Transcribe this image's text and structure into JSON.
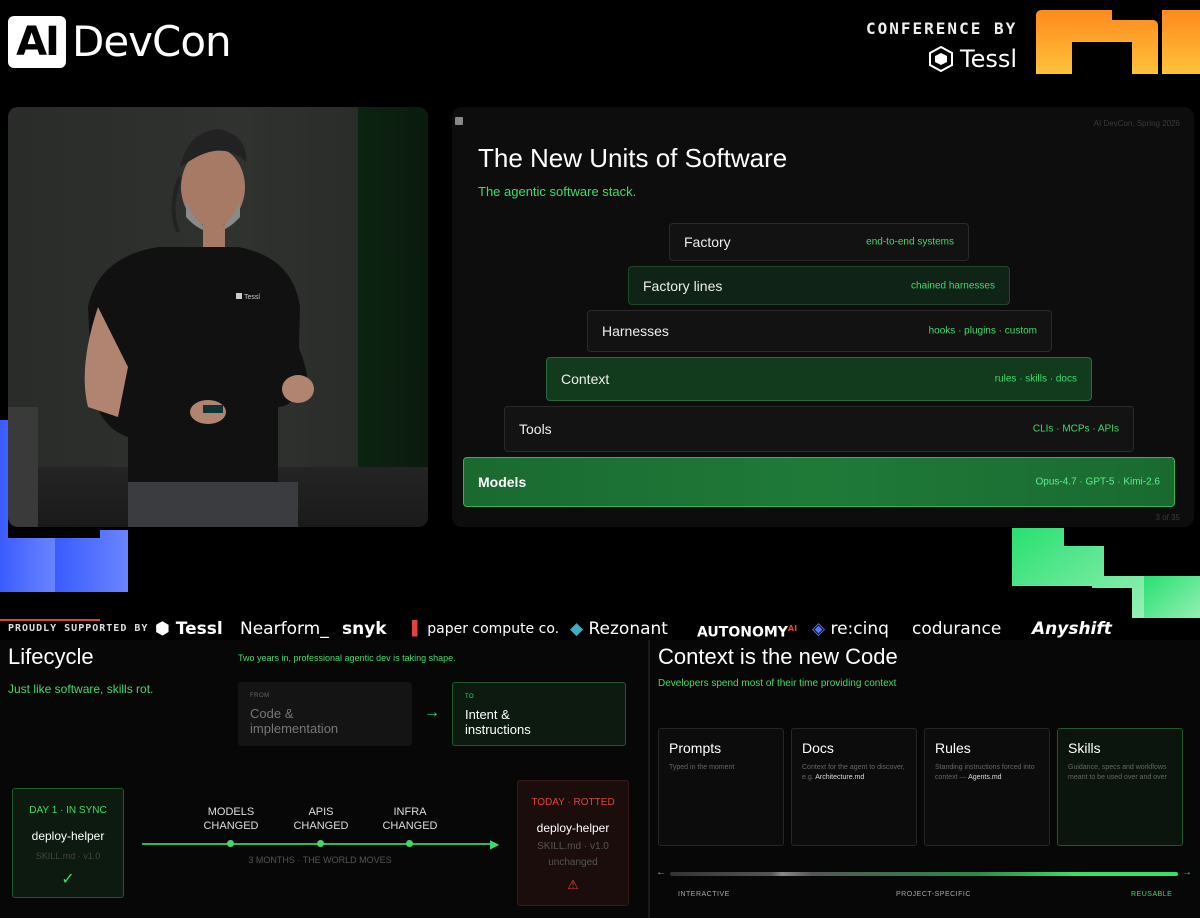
{
  "header": {
    "logo_ai": "AI",
    "logo_name": "DevCon",
    "conference_by": "CONFERENCE BY",
    "tessl": "Tessl"
  },
  "slide": {
    "title": "The New Units of Software",
    "subtitle": "The agentic software stack.",
    "meta": "AI DevCon, Spring 2026",
    "page": "3 of 35",
    "tiers": [
      {
        "name": "Factory",
        "tags": "end-to-end systems"
      },
      {
        "name": "Factory lines",
        "tags": "chained harnesses"
      },
      {
        "name": "Harnesses",
        "tags": "hooks · plugins · custom"
      },
      {
        "name": "Context",
        "tags": "rules · skills · docs"
      },
      {
        "name": "Tools",
        "tags": "CLIs · MCPs · APIs"
      },
      {
        "name": "Models",
        "tags": "Opus-4.7 · GPT-5 · Kimi-2.6"
      }
    ]
  },
  "sponsors": {
    "label": "PROUDLY SUPPORTED BY",
    "items": [
      "Tessl",
      "Nearform_",
      "snyk",
      "paper compute co.",
      "Rezonant",
      "AUTONOMY",
      "re:cinq",
      "codurance",
      "Anyshift"
    ],
    "autonomy_suffix": "AI"
  },
  "lifecycle": {
    "title": "Lifecycle",
    "subtitle": "Just like software, skills rot.",
    "note": "Two years in, professional agentic dev is taking shape.",
    "from_cap": "FROM",
    "from_text": [
      "Code &",
      "implementation"
    ],
    "to_cap": "TO",
    "to_text": [
      "Intent &",
      "instructions"
    ],
    "day1": {
      "status": "DAY 1 · IN SYNC",
      "name": "deploy-helper",
      "file": "SKILL.md · v1.0",
      "mark": "✓"
    },
    "events": [
      {
        "l1": "MODELS",
        "l2": "CHANGED"
      },
      {
        "l1": "APIS",
        "l2": "CHANGED"
      },
      {
        "l1": "INFRA",
        "l2": "CHANGED"
      }
    ],
    "timeline_caption": "3 MONTHS · THE WORLD MOVES",
    "today": {
      "status": "TODAY · ROTTED",
      "name": "deploy-helper",
      "file": "SKILL.md · v1.0",
      "state": "unchanged",
      "mark": "⚠"
    }
  },
  "context": {
    "title": "Context is the new Code",
    "subtitle": "Developers spend most of their time providing context",
    "cards": [
      {
        "title": "Prompts",
        "desc": "Typed in the moment",
        "em": ""
      },
      {
        "title": "Docs",
        "desc": "Context for the agent to discover, e.g. ",
        "em": "Architecture.md"
      },
      {
        "title": "Rules",
        "desc": "Standing instructions forced into context — ",
        "em": "Agents.md"
      },
      {
        "title": "Skills",
        "desc": "Guidance, specs and workflows meant to be used over and over",
        "em": ""
      }
    ],
    "scale": {
      "left": "INTERACTIVE",
      "mid": "PROJECT-SPECIFIC",
      "right": "REUSABLE",
      "arrow_left": "←",
      "arrow_right": "→"
    }
  },
  "colors": {
    "accent": "#3ddc6a",
    "danger": "#e0443c",
    "orange": "#ffa028",
    "blue": "#5a78ff"
  }
}
